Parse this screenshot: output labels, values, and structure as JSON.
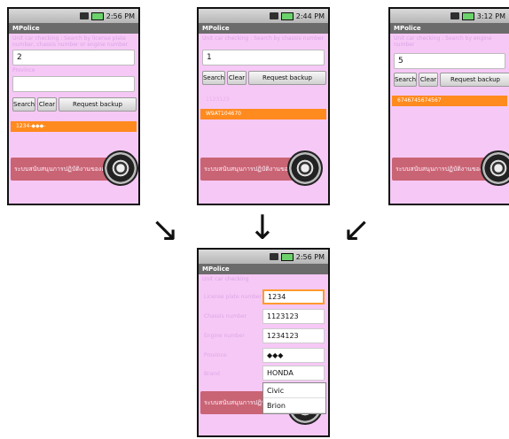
{
  "phone1": {
    "time": "2:56 PM",
    "app_title": "MPolice",
    "hint": "Unit car checking : Search by license plate number, chassis number or engine number",
    "input_value": "2",
    "province_hint": "Province",
    "buttons": {
      "search": "Search",
      "clear": "Clear",
      "backup": "Request backup"
    },
    "result": "1234-◆◆◆-",
    "banner": "ระบบสนับสนุนการปฏิบัติงานของตำรวจ"
  },
  "phone2": {
    "time": "2:44 PM",
    "app_title": "MPolice",
    "hint": "Unit car checking : Search by chassis number",
    "input_value": "1",
    "buttons": {
      "search": "Search",
      "clear": "Clear",
      "backup": "Request backup"
    },
    "results": [
      "1123123",
      "W9AT104670"
    ],
    "banner": "ระบบสนับสนุนการปฏิบัติงานของตำรวจ"
  },
  "phone3": {
    "time": "3:12 PM",
    "app_title": "MPolice",
    "hint": "Unit car checking : Search by engine number",
    "input_value": "5",
    "buttons": {
      "search": "Search",
      "clear": "Clear",
      "backup": "Request backup"
    },
    "result": "6746745674567",
    "banner": "ระบบสนับสนุนการปฏิบัติงานของตำรวจ"
  },
  "phone4": {
    "time": "2:56 PM",
    "app_title": "MPolice",
    "heading": "Unit car checking",
    "fields": [
      {
        "label": "License plate number",
        "value": "1234"
      },
      {
        "label": "Chassis number",
        "value": "1123123"
      },
      {
        "label": "Engine number",
        "value": "1234123"
      },
      {
        "label": "Province",
        "value": "◆◆◆"
      },
      {
        "label": "Brand",
        "value": "HONDA"
      }
    ],
    "dropdown": [
      "Civic",
      "Brion"
    ],
    "banner": "ระบบสนับสนุนการปฏิบัติงานของตำรวจ"
  },
  "arrows": {
    "left": "↘",
    "center": "↓",
    "right": "↙"
  }
}
